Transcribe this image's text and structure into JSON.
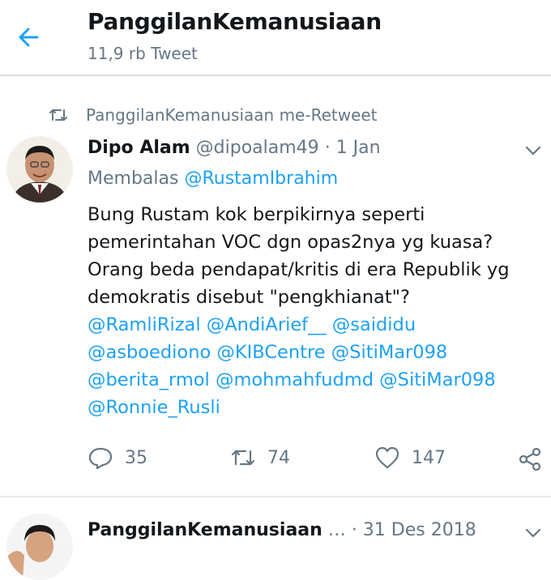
{
  "header": {
    "title": "PanggilanKemanusiaan",
    "subtitle": "11,9 rb Tweet"
  },
  "retweet_bar": {
    "label": "PanggilanKemanusiaan me-Retweet"
  },
  "tweet": {
    "name": "Dipo Alam",
    "handle": "@dipoalam49",
    "separator": "·",
    "time": "1 Jan",
    "reply_prefix": "Membalas",
    "reply_to": "@RustamIbrahim",
    "text_lines": [
      "Bung Rustam kok berpikirnya seperti",
      "pemerintahan VOC dgn opas2nya yg kuasa?",
      "Orang beda pendapat/kritis di era Republik yg",
      "demokratis disebut \"pengkhianat\"?"
    ],
    "mentions": {
      "ramli": "@RamliRizal",
      "andi": "@AndiArief__",
      "said": "@saididu",
      "asbo": "@asboediono",
      "kib": "@KIBCentre",
      "siti1": "@SitiMar098",
      "berita": "@berita_rmol",
      "mahfud": "@mohmahfudmd",
      "siti2": "@SitiMar098",
      "ronnie": "@Ronnie_Rusli"
    },
    "replies": "35",
    "retweets": "74",
    "likes": "147"
  },
  "next_tweet": {
    "name": "PanggilanKemanusiaan",
    "ellipsis": "…",
    "separator": "·",
    "time": "31 Des 2018"
  },
  "colors": {
    "accent": "#1da1f2",
    "secondary_text": "#657786",
    "primary_text": "#14171a"
  },
  "icons": [
    "back-arrow-icon",
    "retweet-icon",
    "chevron-down-icon",
    "reply-icon",
    "heart-icon",
    "share-icon"
  ]
}
